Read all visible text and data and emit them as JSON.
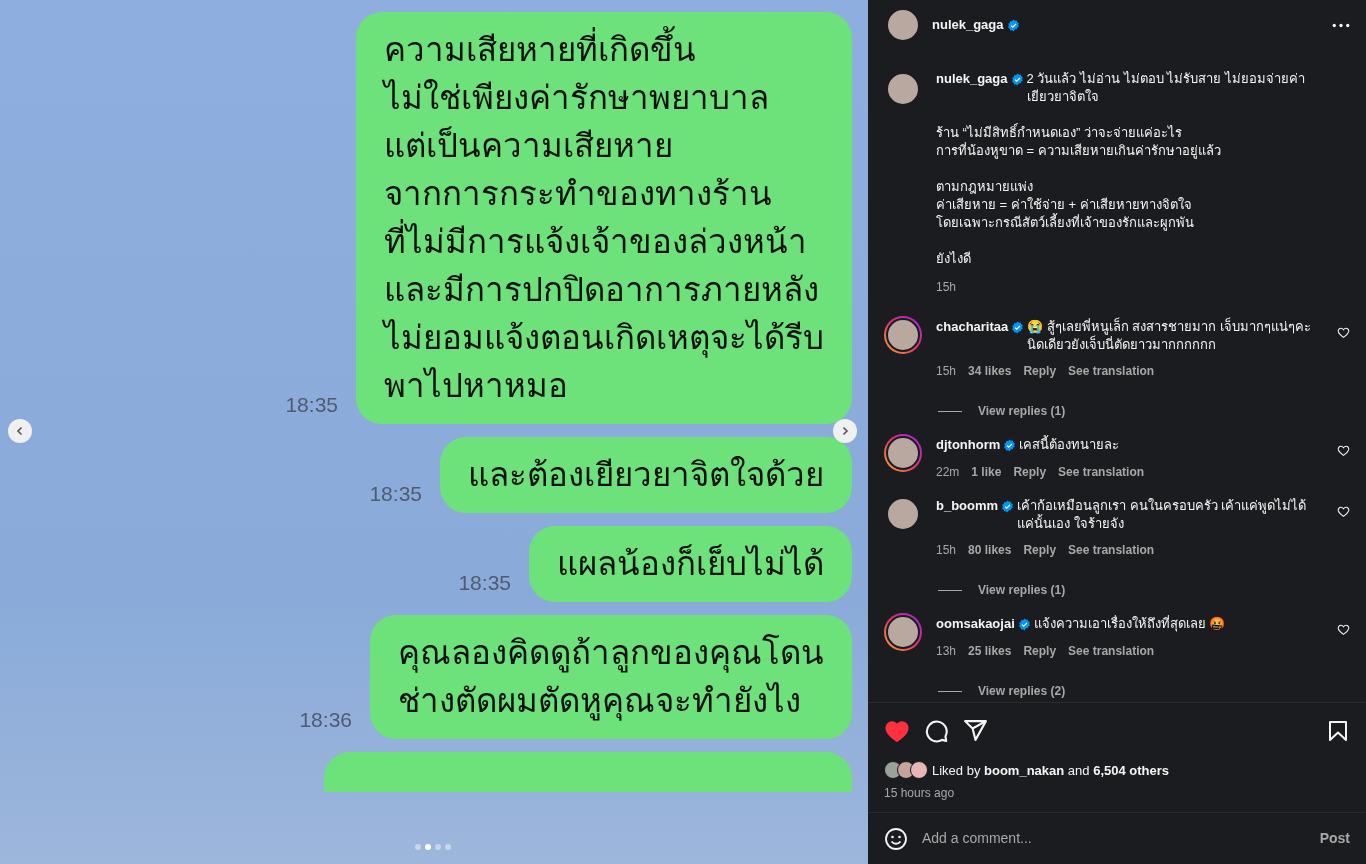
{
  "post_image": {
    "messages": [
      {
        "text": "ความเสียหายที่เกิดขึ้น\nไม่ใช่เพียงค่ารักษาพยาบาล\nแต่เป็นความเสียหาย\nจากการกระทำของทางร้าน\nที่ไม่มีการแจ้งเจ้าของล่วงหน้า\nและมีการปกปิดอาการภายหลัง\nไม่ยอมแจ้งตอนเกิดเหตุจะได้รีบ\nพาไปหาหมอ",
        "time": "18:35"
      },
      {
        "text": "และต้องเยียวยาจิตใจด้วย",
        "time": "18:35"
      },
      {
        "text": "แผลน้องก็เย็บไม่ได้",
        "time": "18:35"
      },
      {
        "text": "คุณลองคิดดูถ้าลูกของคุณโดน\nช่างตัดผมตัดหูคุณจะทำยังไง",
        "time": "18:36"
      }
    ],
    "dots": [
      {
        "selected": false
      },
      {
        "selected": true
      },
      {
        "selected": false
      },
      {
        "selected": false
      }
    ]
  },
  "author": {
    "username": "nulek_gaga",
    "verified": true
  },
  "caption": {
    "username": "nulek_gaga",
    "verified": true,
    "paragraphs": [
      "2 วันแล้ว ไม่อ่าน ไม่ตอบ ไม่รับสาย ไม่ยอมจ่ายค่าเยียวยาจิตใจ",
      "ร้าน “ไม่มีสิทธิ์กำหนดเอง” ว่าจะจ่ายแค่อะไร\nการที่น้องหูขาด = ความเสียหายเกินค่ารักษาอยู่แล้ว",
      "ตามกฎหมายแพ่ง\nค่าเสียหาย = ค่าใช้จ่าย + ค่าเสียหายทางจิตใจ\nโดยเฉพาะกรณีสัตว์เลี้ยงที่เจ้าของรักและผูกพัน",
      "ยังไงดี"
    ],
    "time": "15h"
  },
  "comments": [
    {
      "username": "chacharitaa",
      "verified": true,
      "story_ring": true,
      "text": "😭 สู้ๆเลยพี่หนูเล็ก สงสารชายมาก เจ็บมากๆแน่ๆคะ นิดเดียวยังเจ็บนี่ตัดยาวมากกกกกก",
      "time": "15h",
      "likes": "34 likes",
      "reply": "Reply",
      "translate": "See translation",
      "view_replies": "View replies (1)",
      "liked": false
    },
    {
      "username": "djtonhorm",
      "verified": true,
      "story_ring": true,
      "text": "เคสนี้ต้องทนายละ",
      "time": "22m",
      "likes": "1 like",
      "reply": "Reply",
      "translate": "See translation",
      "liked": false
    },
    {
      "username": "b_boomm",
      "verified": true,
      "story_ring": false,
      "text": "เค้าก้อเหมือนลูกเรา คนในครอบครัว เค้าแค่พูดไม่ได้ แค่นั้นเอง ใจร้ายจัง",
      "time": "15h",
      "likes": "80 likes",
      "reply": "Reply",
      "translate": "See translation",
      "view_replies": "View replies (1)",
      "liked": false
    },
    {
      "username": "oomsakaojai",
      "verified": true,
      "story_ring": true,
      "text": "แจ้งความเอาเรื่องให้ถึงที่สุดเลย 🤬",
      "time": "13h",
      "likes": "25 likes",
      "reply": "Reply",
      "translate": "See translation",
      "view_replies": "View replies (2)",
      "liked": false
    }
  ],
  "actions": {
    "liked": true,
    "saved": false
  },
  "likes": {
    "text": "Liked by **boom_nakan** and **6,504 others**"
  },
  "posted": "15 hours ago",
  "comment_box": {
    "placeholder": "Add a comment...",
    "post": "Post"
  }
}
